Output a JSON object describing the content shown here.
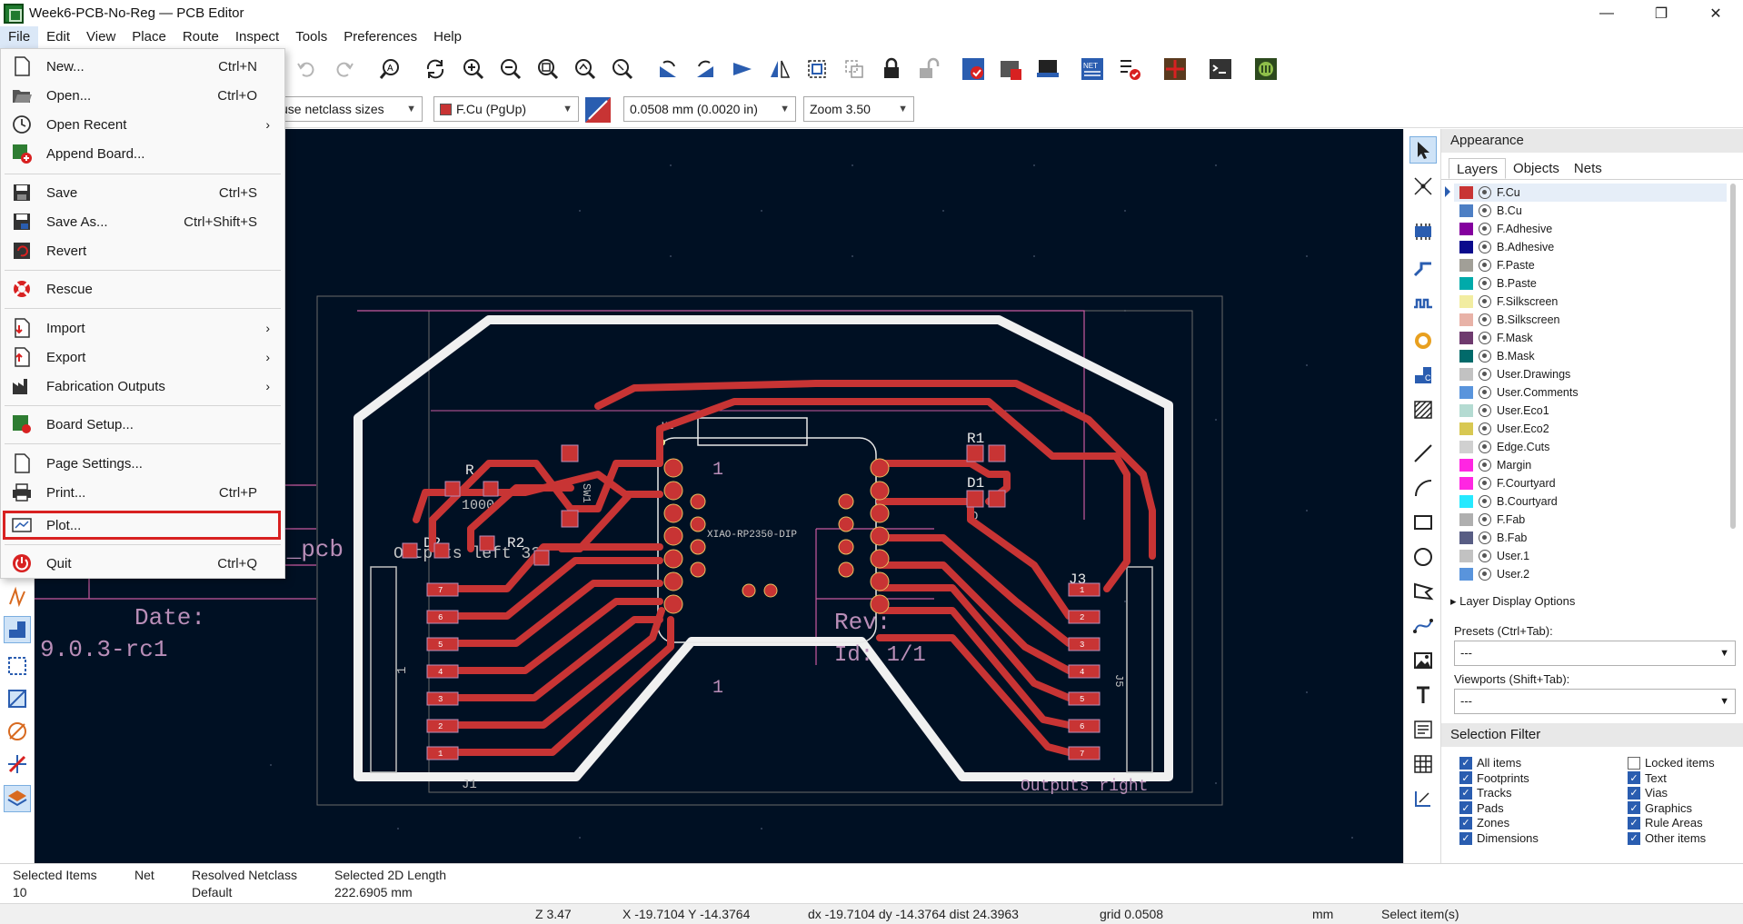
{
  "window": {
    "title": "Week6-PCB-No-Reg — PCB Editor",
    "minimize": "—",
    "maximize": "❐",
    "close": "✕"
  },
  "menubar": [
    "File",
    "Edit",
    "View",
    "Place",
    "Route",
    "Inspect",
    "Tools",
    "Preferences",
    "Help"
  ],
  "toolbar2": {
    "track_width": "use netclass sizes",
    "layer": "F.Cu (PgUp)",
    "layer_color": "#c83434",
    "grid": "0.0508 mm (0.0020 in)",
    "zoom": "Zoom 3.50"
  },
  "file_menu": {
    "new": {
      "label": "New...",
      "shortcut": "Ctrl+N"
    },
    "open": {
      "label": "Open...",
      "shortcut": "Ctrl+O"
    },
    "open_recent": {
      "label": "Open Recent",
      "submenu": "›"
    },
    "append_board": {
      "label": "Append Board..."
    },
    "save": {
      "label": "Save",
      "shortcut": "Ctrl+S"
    },
    "save_as": {
      "label": "Save As...",
      "shortcut": "Ctrl+Shift+S"
    },
    "revert": {
      "label": "Revert"
    },
    "rescue": {
      "label": "Rescue"
    },
    "import": {
      "label": "Import",
      "submenu": "›"
    },
    "export": {
      "label": "Export",
      "submenu": "›"
    },
    "fabrication": {
      "label": "Fabrication Outputs",
      "submenu": "›"
    },
    "board_setup": {
      "label": "Board Setup..."
    },
    "page_settings": {
      "label": "Page Settings..."
    },
    "print": {
      "label": "Print...",
      "shortcut": "Ctrl+P"
    },
    "plot": {
      "label": "Plot..."
    },
    "quit": {
      "label": "Quit",
      "shortcut": "Ctrl+Q"
    }
  },
  "canvas": {
    "titleblock_date": "Date:",
    "titleblock_version": "9.0.3-rc1",
    "titleblock_pcb": "d_pcb",
    "titleblock_rev": "Rev:",
    "titleblock_id": "Id: 1/1",
    "outputs_label": "Outputs right",
    "outputs_left_label": "Outputs left 33",
    "num_1a": "1",
    "num_1b": "1",
    "module_label": "XIAO-RP2350-DIP",
    "u1": "U1",
    "r1": "R1",
    "r2": "R2",
    "d1": "D1",
    "d2": "D2",
    "j3": "J3",
    "r_left": "R",
    "val_1000": "1000",
    "d_small": "D",
    "sw_label": "SW1",
    "j_left_num": "1",
    "j_right_num": "J5",
    "j_bottom": "J1",
    "pin_labels_left": [
      "7",
      "6",
      "5",
      "4",
      "3",
      "2",
      "1"
    ],
    "pin_labels_right": [
      "1",
      "2",
      "3",
      "4",
      "5",
      "6",
      "7"
    ]
  },
  "appearance": {
    "header": "Appearance",
    "tabs": [
      "Layers",
      "Objects",
      "Nets"
    ],
    "layers": [
      {
        "name": "F.Cu",
        "color": "#c83434"
      },
      {
        "name": "B.Cu",
        "color": "#4d7fc4"
      },
      {
        "name": "F.Adhesive",
        "color": "#84009e"
      },
      {
        "name": "B.Adhesive",
        "color": "#0a0a8c"
      },
      {
        "name": "F.Paste",
        "color": "#a19f97"
      },
      {
        "name": "B.Paste",
        "color": "#00aaaa"
      },
      {
        "name": "F.Silkscreen",
        "color": "#f2eda1"
      },
      {
        "name": "B.Silkscreen",
        "color": "#e8b2a7"
      },
      {
        "name": "F.Mask",
        "color": "#6e3a6e"
      },
      {
        "name": "B.Mask",
        "color": "#016a6a"
      },
      {
        "name": "User.Drawings",
        "color": "#c2c2c2"
      },
      {
        "name": "User.Comments",
        "color": "#5994dc"
      },
      {
        "name": "User.Eco1",
        "color": "#b4dbd2"
      },
      {
        "name": "User.Eco2",
        "color": "#d8c852"
      },
      {
        "name": "Edge.Cuts",
        "color": "#d0d0d0"
      },
      {
        "name": "Margin",
        "color": "#ff26e2"
      },
      {
        "name": "F.Courtyard",
        "color": "#ff26e2"
      },
      {
        "name": "B.Courtyard",
        "color": "#26e9ff"
      },
      {
        "name": "F.Fab",
        "color": "#afafaf"
      },
      {
        "name": "B.Fab",
        "color": "#585d84"
      },
      {
        "name": "User.1",
        "color": "#c2c2c2"
      },
      {
        "name": "User.2",
        "color": "#5994dc"
      }
    ],
    "layer_display_options": "Layer Display Options",
    "presets_label": "Presets (Ctrl+Tab):",
    "presets_value": "---",
    "viewports_label": "Viewports (Shift+Tab):",
    "viewports_value": "---"
  },
  "selection_filter": {
    "header": "Selection Filter",
    "items": [
      {
        "label": "All items",
        "checked": true
      },
      {
        "label": "Locked items",
        "checked": false
      },
      {
        "label": "Footprints",
        "checked": true
      },
      {
        "label": "Text",
        "checked": true
      },
      {
        "label": "Tracks",
        "checked": true
      },
      {
        "label": "Vias",
        "checked": true
      },
      {
        "label": "Pads",
        "checked": true
      },
      {
        "label": "Graphics",
        "checked": true
      },
      {
        "label": "Zones",
        "checked": true
      },
      {
        "label": "Rule Areas",
        "checked": true
      },
      {
        "label": "Dimensions",
        "checked": true
      },
      {
        "label": "Other items",
        "checked": true
      }
    ]
  },
  "statusbar": {
    "selected_items_label": "Selected Items",
    "selected_items_value": "10",
    "net_label": "Net",
    "resolved_netclass_label": "Resolved Netclass",
    "resolved_netclass_value": "Default",
    "selected_length_label": "Selected 2D Length",
    "selected_length_value": "222.6905 mm",
    "zoom": "Z 3.47",
    "xy": "X -19.7104  Y -14.3764",
    "dxy": "dx -19.7104  dy -14.3764  dist 24.3963",
    "grid": "grid 0.0508",
    "units": "mm",
    "mode": "Select item(s)"
  }
}
